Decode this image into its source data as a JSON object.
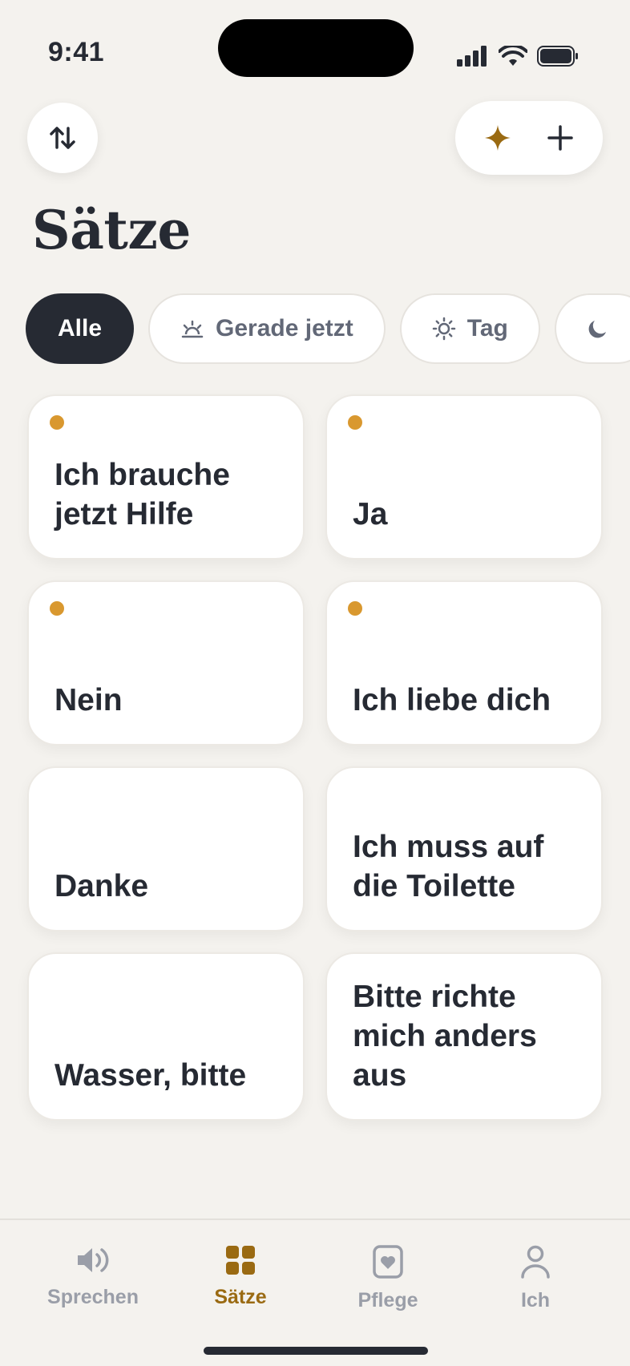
{
  "status_bar": {
    "time": "9:41"
  },
  "header": {
    "title": "Sätze"
  },
  "filters": [
    {
      "label": "Alle",
      "active": true,
      "icon": ""
    },
    {
      "label": "Gerade jetzt",
      "active": false,
      "icon": "sunrise-icon"
    },
    {
      "label": "Tag",
      "active": false,
      "icon": "sun-icon"
    },
    {
      "label": "",
      "active": false,
      "icon": "moon-icon"
    }
  ],
  "phrases": [
    {
      "text": "Ich brauche jetzt Hilfe",
      "favorite": true
    },
    {
      "text": "Ja",
      "favorite": true
    },
    {
      "text": "Nein",
      "favorite": true
    },
    {
      "text": "Ich liebe dich",
      "favorite": true
    },
    {
      "text": "Danke",
      "favorite": false
    },
    {
      "text": "Ich muss auf die Toilette",
      "favorite": false
    },
    {
      "text": "Wasser, bitte",
      "favorite": false
    },
    {
      "text": "Bitte richte mich anders aus",
      "favorite": false
    }
  ],
  "tabbar": {
    "items": [
      {
        "label": "Sprechen",
        "icon": "speaker-icon",
        "active": false
      },
      {
        "label": "Sätze",
        "icon": "grid-icon",
        "active": true
      },
      {
        "label": "Pflege",
        "icon": "heart-card-icon",
        "active": false
      },
      {
        "label": "Ich",
        "icon": "person-icon",
        "active": false
      }
    ]
  },
  "colors": {
    "accent": "#9A6A12",
    "dot": "#D9982F",
    "dark": "#262A33",
    "background": "#F4F2EE"
  }
}
